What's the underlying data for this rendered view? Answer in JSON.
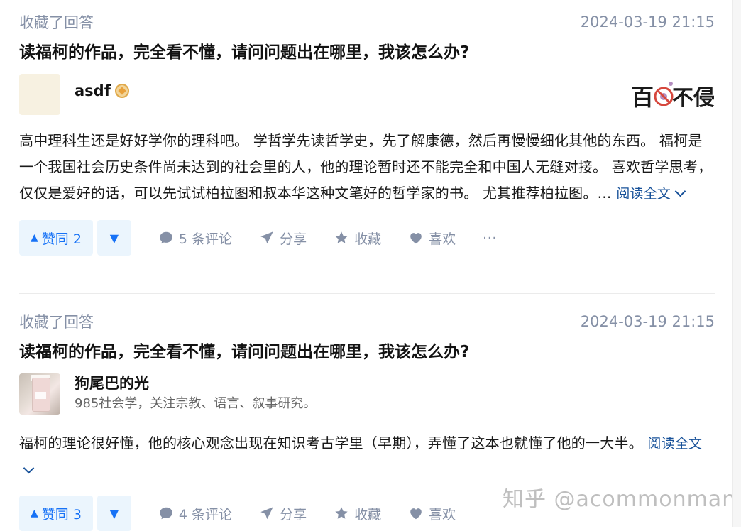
{
  "feed": {
    "items": [
      {
        "activity": "收藏了回答",
        "timestamp": "2024-03-19 21:15",
        "question_title": "读福柯的作品，完全看不懂，请问问题出在哪里，我该怎么办?",
        "author": {
          "name": "asdf",
          "headline": ""
        },
        "brand_logo_text": "百不侵",
        "excerpt": "高中理科生还是好好学你的理科吧。 学哲学先读哲学史，先了解康德，然后再慢慢细化其他的东西。 福柯是一个我国社会历史条件尚未达到的社会里的人，他的理论暂时还不能完全和中国人无缝对接。 喜欢哲学思考，仅仅是爱好的话，可以先试试柏拉图和叔本华这种文笔好的哲学家的书。 尤其推荐柏拉图。…",
        "read_more": "阅读全文",
        "upvote": "赞同 2",
        "comments": "5 条评论",
        "share": "分享",
        "favorite": "收藏",
        "like": "喜欢",
        "more": "···"
      },
      {
        "activity": "收藏了回答",
        "timestamp": "2024-03-19 21:15",
        "question_title": "读福柯的作品，完全看不懂，请问问题出在哪里，我该怎么办?",
        "author": {
          "name": "狗尾巴的光",
          "headline": "985社会学，关注宗教、语言、叙事研究。"
        },
        "excerpt": "福柯的理论很好懂，他的核心观念出现在知识考古学里（早期），弄懂了这本也就懂了他的一大半。",
        "read_more": "阅读全文",
        "upvote": "赞同 3",
        "comments": "4 条评论",
        "share": "分享",
        "favorite": "收藏",
        "like": "喜欢"
      }
    ]
  },
  "watermark": "知乎 @acommonman",
  "colors": {
    "accent": "#1772f6",
    "accent_bg": "#ebf5fd",
    "meta_gray": "#8590a6",
    "link_blue": "#175199"
  },
  "icons": [
    "comment-icon",
    "share-icon",
    "star-icon",
    "heart-icon",
    "chevron-down-icon",
    "vote-up-icon",
    "vote-down-icon",
    "verified-badge-icon"
  ]
}
